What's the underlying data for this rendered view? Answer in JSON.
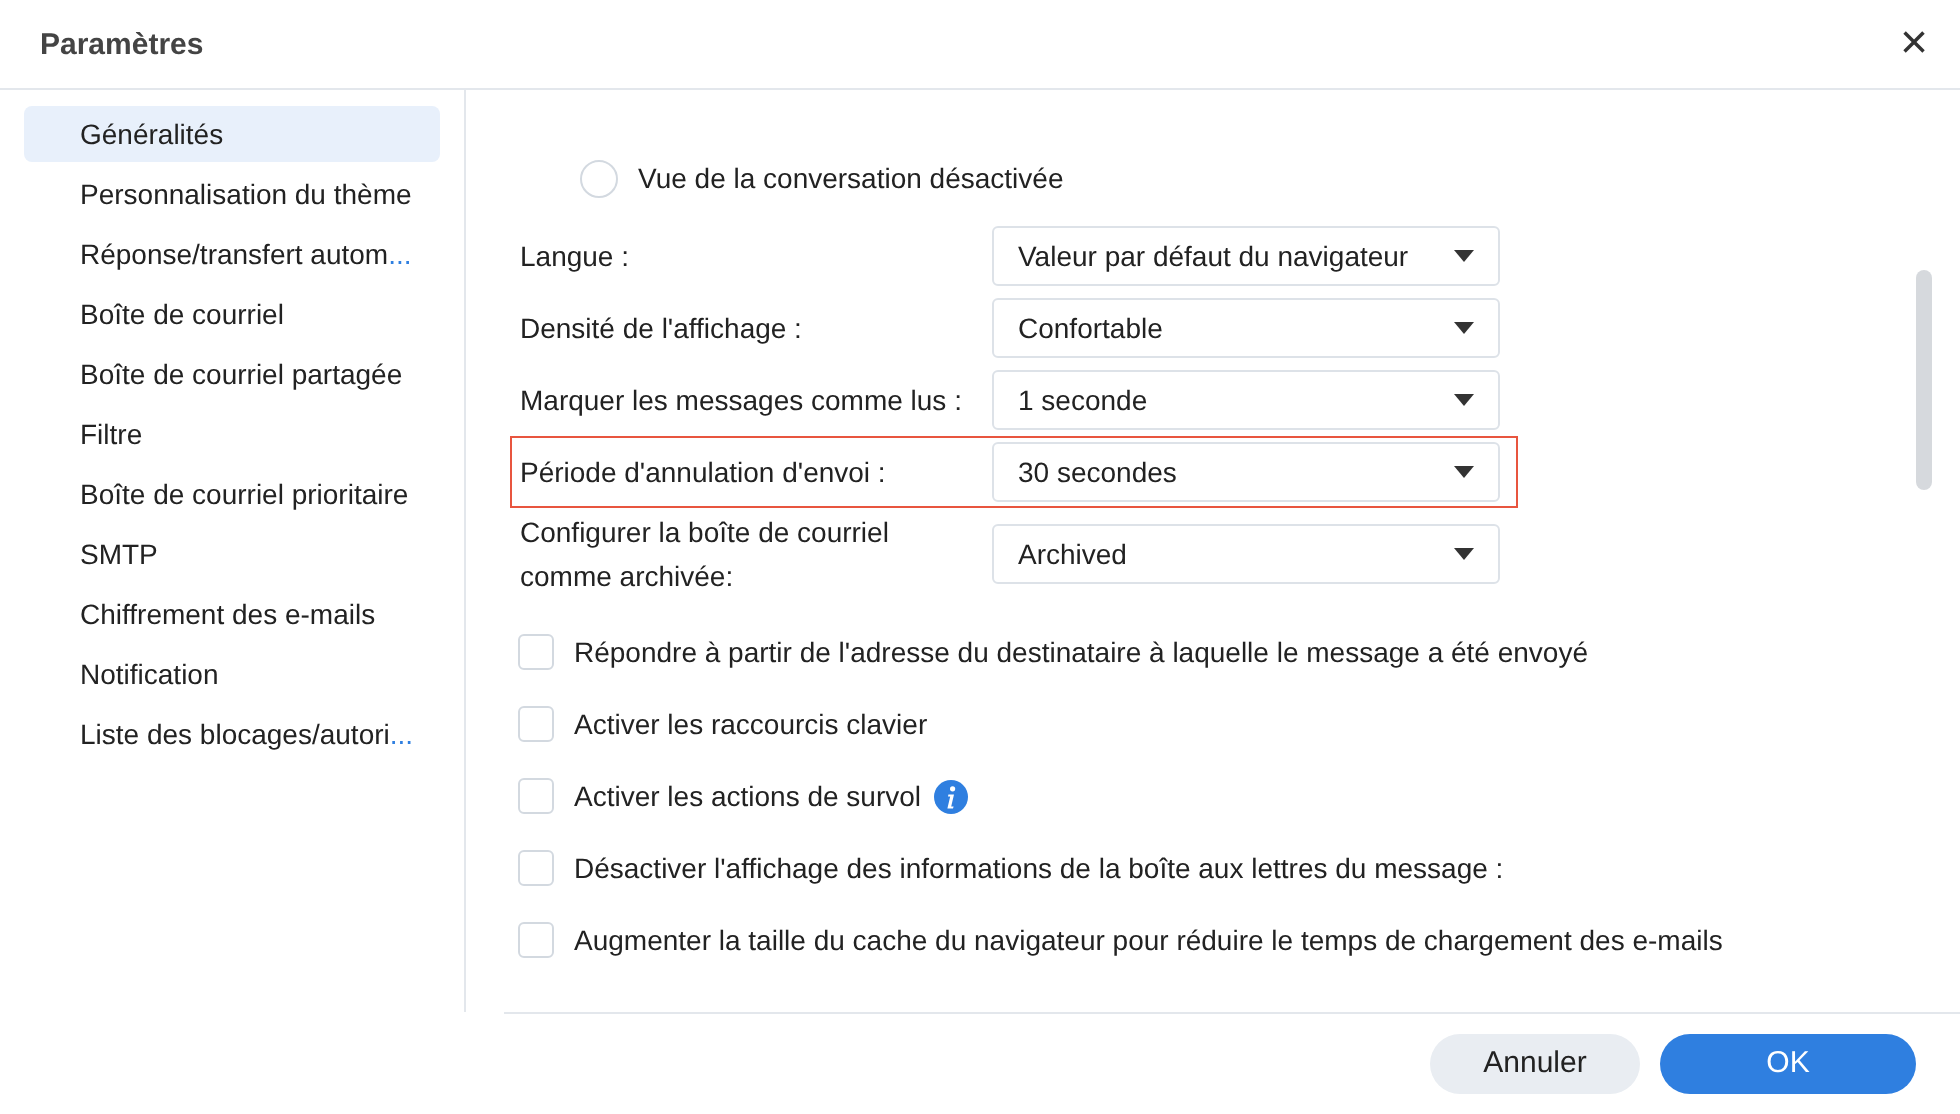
{
  "window": {
    "title": "Paramètres",
    "close": "×"
  },
  "sidebar": {
    "items": [
      {
        "label": "Généralités",
        "selected": true,
        "truncated": false
      },
      {
        "label": "Personnalisation du thème",
        "selected": false,
        "truncated": false
      },
      {
        "label": "Réponse/transfert autom...",
        "selected": false,
        "truncated": true
      },
      {
        "label": "Boîte de courriel",
        "selected": false,
        "truncated": false
      },
      {
        "label": "Boîte de courriel partagée",
        "selected": false,
        "truncated": false
      },
      {
        "label": "Filtre",
        "selected": false,
        "truncated": false
      },
      {
        "label": "Boîte de courriel prioritaire",
        "selected": false,
        "truncated": false
      },
      {
        "label": "SMTP",
        "selected": false,
        "truncated": false
      },
      {
        "label": "Chiffrement des e-mails",
        "selected": false,
        "truncated": false
      },
      {
        "label": "Notification",
        "selected": false,
        "truncated": false
      },
      {
        "label": "Liste des blocages/autori...",
        "selected": false,
        "truncated": true
      }
    ]
  },
  "radio": {
    "label": "Vue de la conversation désactivée",
    "selected": false
  },
  "settings": [
    {
      "label": "Langue :",
      "value": "Valeur par défaut du navigateur",
      "highlighted": false
    },
    {
      "label": "Densité de l'affichage :",
      "value": "Confortable",
      "highlighted": false
    },
    {
      "label": "Marquer les messages comme lus :",
      "value": "1 seconde",
      "highlighted": false
    },
    {
      "label": "Période d'annulation d'envoi :",
      "value": "30 secondes",
      "highlighted": true
    },
    {
      "label": "Configurer la boîte de courriel comme archivée:",
      "value": "Archived",
      "highlighted": false
    }
  ],
  "options": [
    {
      "label": "Répondre à partir de l'adresse du destinataire à laquelle le message a été envoyé",
      "checked": false,
      "info": false
    },
    {
      "label": "Activer les raccourcis clavier",
      "checked": false,
      "info": false
    },
    {
      "label": "Activer les actions de survol",
      "checked": false,
      "info": true
    },
    {
      "label": "Désactiver l'affichage des informations de la boîte aux lettres du message :",
      "checked": false,
      "info": false
    },
    {
      "label": "Augmenter la taille du cache du navigateur pour réduire le temps de chargement des e-mails",
      "checked": false,
      "info": false
    }
  ],
  "buttons": [
    {
      "label": "Annuler",
      "kind": "secondary"
    },
    {
      "label": "OK",
      "kind": "primary"
    }
  ]
}
